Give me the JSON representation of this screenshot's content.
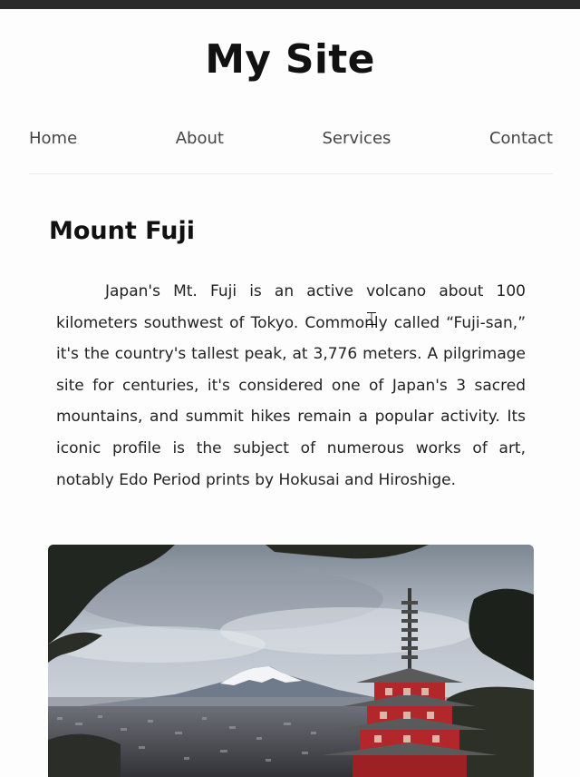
{
  "site": {
    "title": "My Site"
  },
  "nav": {
    "items": [
      {
        "label": "Home"
      },
      {
        "label": "About"
      },
      {
        "label": "Services"
      },
      {
        "label": "Contact"
      }
    ]
  },
  "article": {
    "heading": "Mount Fuji",
    "body": "Japan's Mt. Fuji is an active volcano about 100 kilometers southwest of Tokyo. Commonly called “Fuji-san,” it's the country's tallest peak, at 3,776 meters. A pilgrimage site for centuries, it's considered one of Japan's 3 sacred mountains, and summit hikes remain a popular activity. Its iconic profile is the subject of numerous works of art, notably Edo Period prints by Hokusai and Hiroshige."
  },
  "image": {
    "subject": "mount-fuji-with-pagoda"
  },
  "colors": {
    "background": "#fdfdfd",
    "text": "#222222",
    "nav_text": "#454545",
    "pagoda_red": "#b3262a"
  }
}
